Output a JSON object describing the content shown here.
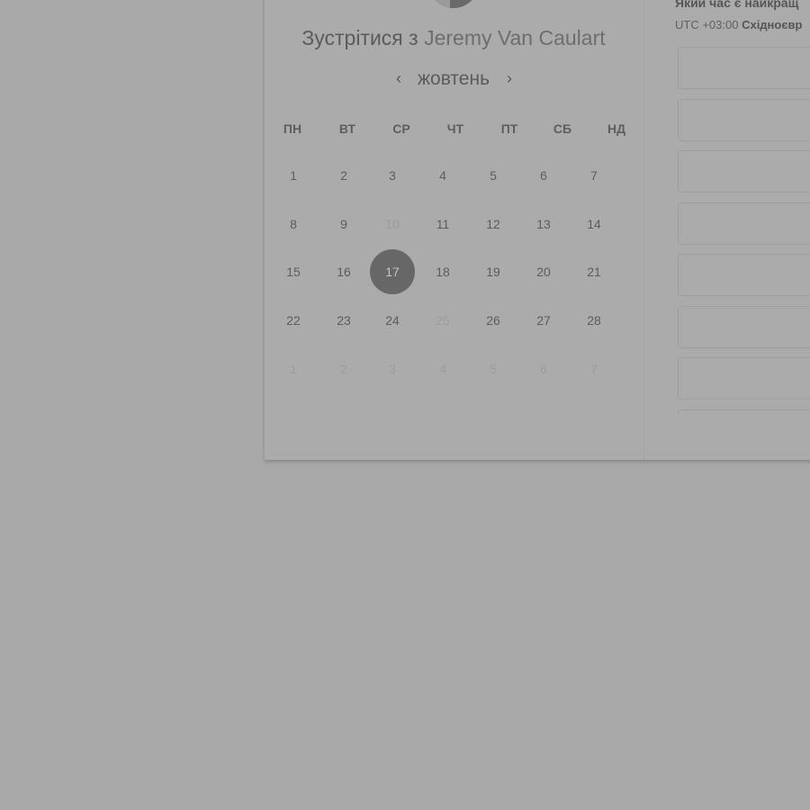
{
  "header": {
    "title_prefix": "Зустрітися з",
    "title_name": "Jeremy Van Caulart"
  },
  "calendar": {
    "month": "жовтень",
    "prev_icon": "chevron-left-icon",
    "next_icon": "chevron-right-icon",
    "weekdays": [
      "ПН",
      "ВТ",
      "СР",
      "ЧТ",
      "ПТ",
      "СБ",
      "НД"
    ],
    "weeks": [
      [
        {
          "d": "1",
          "s": "a"
        },
        {
          "d": "2",
          "s": "a"
        },
        {
          "d": "3",
          "s": "a"
        },
        {
          "d": "4",
          "s": "a"
        },
        {
          "d": "5",
          "s": "a"
        },
        {
          "d": "6",
          "s": "a"
        },
        {
          "d": "7",
          "s": "a"
        }
      ],
      [
        {
          "d": "8",
          "s": "a"
        },
        {
          "d": "9",
          "s": "a"
        },
        {
          "d": "10",
          "s": "m"
        },
        {
          "d": "11",
          "s": "a"
        },
        {
          "d": "12",
          "s": "a"
        },
        {
          "d": "13",
          "s": "a"
        },
        {
          "d": "14",
          "s": "a"
        }
      ],
      [
        {
          "d": "15",
          "s": "a"
        },
        {
          "d": "16",
          "s": "a"
        },
        {
          "d": "17",
          "s": "sel"
        },
        {
          "d": "18",
          "s": "a"
        },
        {
          "d": "19",
          "s": "a"
        },
        {
          "d": "20",
          "s": "a"
        },
        {
          "d": "21",
          "s": "a"
        }
      ],
      [
        {
          "d": "22",
          "s": "a"
        },
        {
          "d": "23",
          "s": "a"
        },
        {
          "d": "24",
          "s": "a"
        },
        {
          "d": "25",
          "s": "m"
        },
        {
          "d": "26",
          "s": "a"
        },
        {
          "d": "27",
          "s": "a"
        },
        {
          "d": "28",
          "s": "a"
        }
      ],
      [
        {
          "d": "1",
          "s": "m"
        },
        {
          "d": "2",
          "s": "m"
        },
        {
          "d": "3",
          "s": "m"
        },
        {
          "d": "4",
          "s": "m"
        },
        {
          "d": "5",
          "s": "m"
        },
        {
          "d": "6",
          "s": "m"
        },
        {
          "d": "7",
          "s": "m"
        }
      ]
    ]
  },
  "right_panel": {
    "heading": "Який час є найкращ",
    "tz_offset": "UTC +03:00",
    "tz_name": "Східноєвр",
    "slot_count": 8
  }
}
